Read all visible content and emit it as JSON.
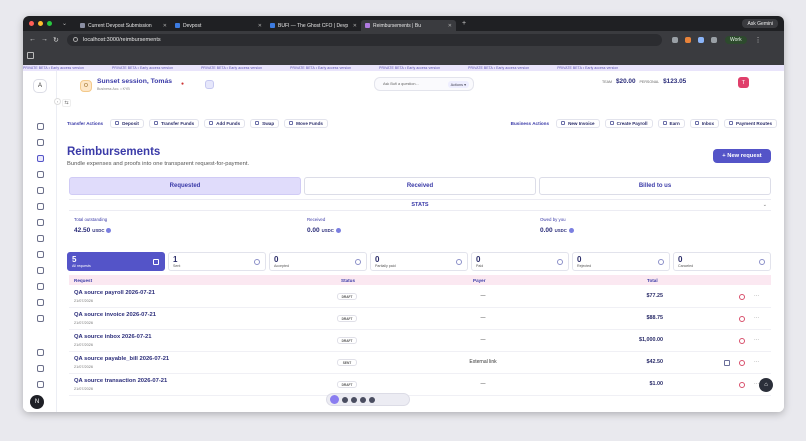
{
  "browser": {
    "tabs": [
      {
        "label": "Current Devpost Submission"
      },
      {
        "label": "Devpost"
      },
      {
        "label": "BUFI — The Ghost CFO | Devp"
      },
      {
        "label": "Reimbursements | Bu"
      }
    ],
    "ask_label": "Ask Gemini",
    "url": "localhost:3000/reimbursements",
    "profile": "Work"
  },
  "marquee": "PRIVATE BETA • Early access version",
  "topbar": {
    "org_initial": "O",
    "org_name": "Sunset session, Tomás",
    "org_sub": "Business Acc. • KYB",
    "ask_placeholder": "Ask Bufi a question...",
    "ask_action": "Actions ▾",
    "team_label": "TEAM",
    "team_amount": "$20.00",
    "personal_label": "PERSONAL",
    "personal_amount": "$123.05",
    "avatar_initial": "T"
  },
  "actions": {
    "transfer_label": "Transfer Actions",
    "transfer_buttons": [
      "Deposit",
      "Transfer Funds",
      "Add Funds",
      "Swap",
      "Move Funds"
    ],
    "business_label": "Business Actions",
    "business_buttons": [
      "New Invoice",
      "Create Payroll",
      "Earn",
      "Inbox",
      "Payment Routes"
    ]
  },
  "page": {
    "title": "Reimbursements",
    "subtitle": "Bundle expenses and proofs into one transparent request-for-payment.",
    "new_request": "+ New request"
  },
  "view_tabs": [
    "Requested",
    "Received",
    "Billed to us"
  ],
  "stats_label": "STATS",
  "totals": [
    {
      "label": "Total outstanding",
      "value": "42.50",
      "unit": "USDC"
    },
    {
      "label": "Received",
      "value": "0.00",
      "unit": "USDC"
    },
    {
      "label": "Owed by you",
      "value": "0.00",
      "unit": "USDC"
    }
  ],
  "status_cards": [
    {
      "count": "5",
      "label": "All requests"
    },
    {
      "count": "1",
      "label": "Sent"
    },
    {
      "count": "0",
      "label": "Accepted"
    },
    {
      "count": "0",
      "label": "Partially paid"
    },
    {
      "count": "0",
      "label": "Paid"
    },
    {
      "count": "0",
      "label": "Rejected"
    },
    {
      "count": "0",
      "label": "Canceled"
    }
  ],
  "table": {
    "headers": {
      "request": "Request",
      "status": "Status",
      "payer": "Payer",
      "total": "Total"
    },
    "rows": [
      {
        "name": "QA source payroll 2026-07-21",
        "date": "21/07/2026",
        "status": "DRAFT",
        "payer": "—",
        "total": "$77.25"
      },
      {
        "name": "QA source invoice 2026-07-21",
        "date": "21/07/2026",
        "status": "DRAFT",
        "payer": "—",
        "total": "$88.75"
      },
      {
        "name": "QA source inbox 2026-07-21",
        "date": "21/07/2026",
        "status": "DRAFT",
        "payer": "—",
        "total": "$1,000.00"
      },
      {
        "name": "QA source payable_bill 2026-07-21",
        "date": "21/07/2026",
        "status": "SENT",
        "payer": "External link",
        "total": "$42.50"
      },
      {
        "name": "QA source transaction 2026-07-21",
        "date": "21/07/2026",
        "status": "DRAFT",
        "payer": "—",
        "total": "$1.00"
      }
    ]
  },
  "colors": {
    "accent": "#5454c8",
    "title": "#3b3ba8",
    "danger": "#d84f6b"
  }
}
